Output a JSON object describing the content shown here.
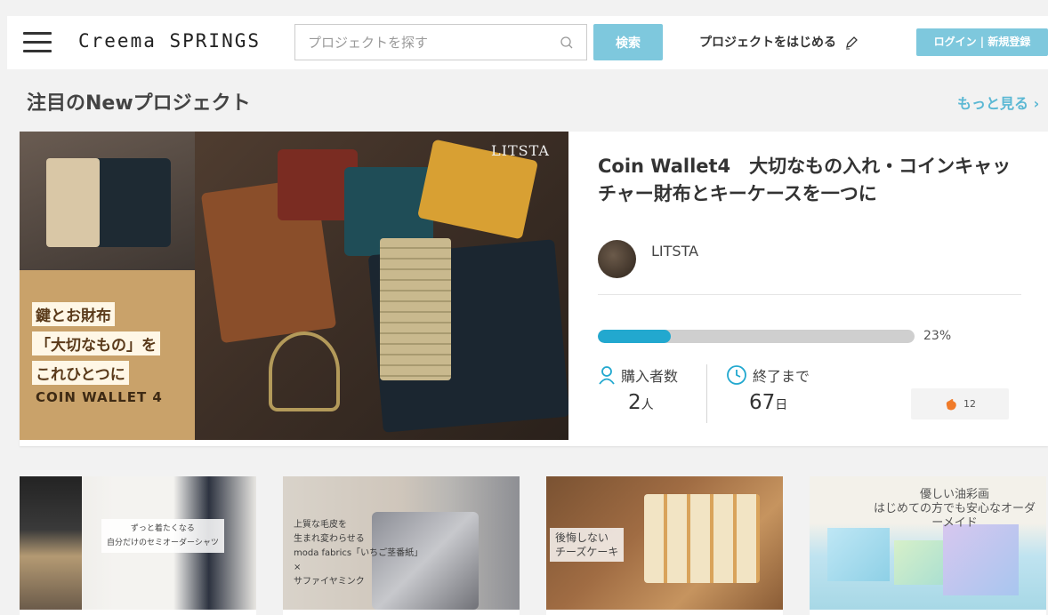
{
  "header": {
    "logo": "Creema SPRINGS",
    "search_placeholder": "プロジェクトを探す",
    "search_button": "検索",
    "start_project": "プロジェクトをはじめる",
    "login": "ログイン | 新規登録"
  },
  "section": {
    "title": "注目のNewプロジェクト",
    "more": "もっと見る ›"
  },
  "featured": {
    "image_text": {
      "line1": "鍵とお財布",
      "line2": "「大切なもの」を",
      "line3": "これひとつに",
      "brand": "COIN WALLET 4",
      "watermark": "LITSTA"
    },
    "title": "Coin Wallet4　大切なもの入れ・コインキャッチャー財布とキーケースを一つに",
    "owner": "LITSTA",
    "progress": 0.23,
    "progress_label": "23%",
    "buyers_label": "購入者数",
    "buyers_value": "2",
    "buyers_unit": "人",
    "remaining_label": "終了まで",
    "remaining_value": "67",
    "remaining_unit": "日",
    "likes": "12"
  },
  "cards": [
    {
      "caption": "ずっと着たくなる\n自分だけのセミオーダーシャツ"
    },
    {
      "caption": "上質な毛皮を\n生まれ変わらせる\nmoda fabrics「いちご茎番紙」\n×\nサファイヤミンク"
    },
    {
      "caption": "後悔しない\nチーズケーキ"
    },
    {
      "caption": "優しい油彩画\nはじめての方でも安心なオーダーメイド"
    }
  ],
  "colors": {
    "accent": "#7ec8dd",
    "progress": "#22a8cf",
    "link": "#5bb8d4"
  }
}
